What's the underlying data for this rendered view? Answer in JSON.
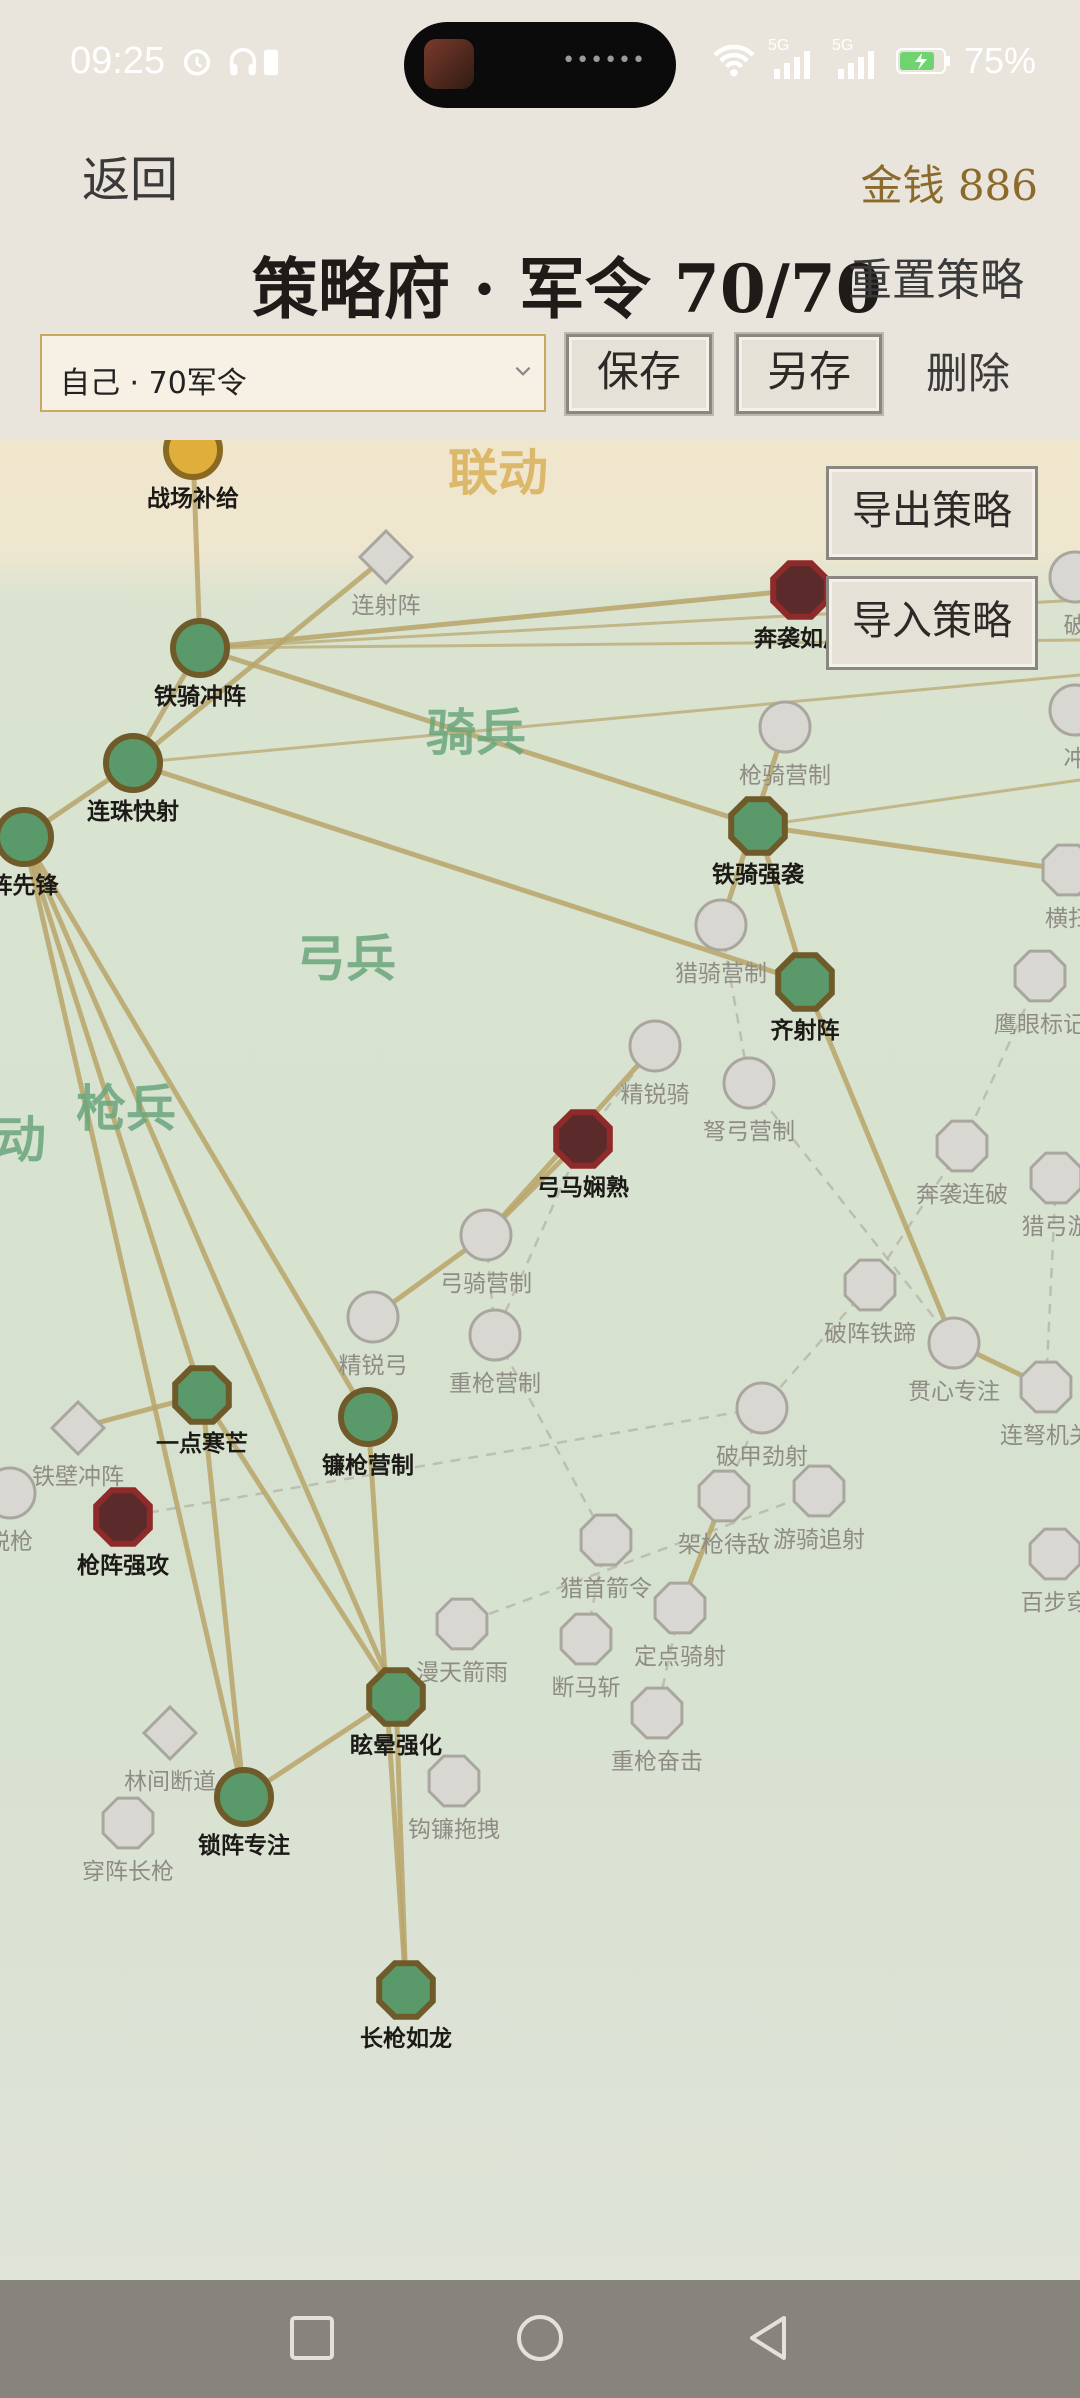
{
  "status_bar": {
    "time": "09:25",
    "network_1": "5G",
    "network_2": "5G",
    "battery": "75%"
  },
  "header": {
    "back_label": "返回",
    "money": "金钱 886",
    "title": "策略府 · 军令 70/70",
    "reset_label": "重置策略"
  },
  "toolbar": {
    "loadout_value": "自己 · 70军令",
    "save_label": "保存",
    "save_as_label": "另存",
    "delete_label": "删除"
  },
  "map": {
    "export_label": "导出策略",
    "import_label": "导入策略",
    "regions": [
      {
        "label": "联动",
        "color": "#d9b15a"
      },
      {
        "label": "骑兵",
        "color": "#6aa67c"
      },
      {
        "label": "弓兵",
        "color": "#6aa67c"
      },
      {
        "label": "枪兵",
        "color": "#6aa67c"
      },
      {
        "label": "动",
        "color": "#6aa67c"
      }
    ],
    "nodes": [
      {
        "label": "战场补给",
        "state": "gold",
        "shape": "circle"
      },
      {
        "label": "连射阵",
        "state": "locked",
        "shape": "diamond"
      },
      {
        "label": "铁骑冲阵",
        "state": "active",
        "shape": "circle"
      },
      {
        "label": "奔袭如风",
        "state": "enemy",
        "shape": "octagon"
      },
      {
        "label": "连珠快射",
        "state": "active",
        "shape": "circle"
      },
      {
        "label": "枪骑营制",
        "state": "locked",
        "shape": "circle"
      },
      {
        "label": "阵先锋",
        "state": "active",
        "shape": "circle"
      },
      {
        "label": "铁骑强袭",
        "state": "active",
        "shape": "octagon"
      },
      {
        "label": "横扫",
        "state": "locked",
        "shape": "octagon"
      },
      {
        "label": "猎骑营制",
        "state": "locked",
        "shape": "circle"
      },
      {
        "label": "齐射阵",
        "state": "active",
        "shape": "octagon"
      },
      {
        "label": "鹰眼标记",
        "state": "locked",
        "shape": "octagon"
      },
      {
        "label": "精锐骑",
        "state": "locked",
        "shape": "circle"
      },
      {
        "label": "弩弓营制",
        "state": "locked",
        "shape": "circle"
      },
      {
        "label": "弓马娴熟",
        "state": "enemy",
        "shape": "octagon"
      },
      {
        "label": "奔袭连破",
        "state": "locked",
        "shape": "octagon"
      },
      {
        "label": "猎弓游",
        "state": "locked",
        "shape": "octagon"
      },
      {
        "label": "弓骑营制",
        "state": "locked",
        "shape": "circle"
      },
      {
        "label": "破阵铁蹄",
        "state": "locked",
        "shape": "octagon"
      },
      {
        "label": "精锐弓",
        "state": "locked",
        "shape": "circle"
      },
      {
        "label": "重枪营制",
        "state": "locked",
        "shape": "circle"
      },
      {
        "label": "贯心专注",
        "state": "locked",
        "shape": "circle"
      },
      {
        "label": "一点寒芒",
        "state": "active",
        "shape": "octagon"
      },
      {
        "label": "镰枪营制",
        "state": "active",
        "shape": "circle"
      },
      {
        "label": "破甲劲射",
        "state": "locked",
        "shape": "circle"
      },
      {
        "label": "连弩机关",
        "state": "locked",
        "shape": "octagon"
      },
      {
        "label": "铁壁冲阵",
        "state": "locked",
        "shape": "diamond"
      },
      {
        "label": "锐枪",
        "state": "locked",
        "shape": "circle"
      },
      {
        "label": "枪阵强攻",
        "state": "enemy",
        "shape": "octagon"
      },
      {
        "label": "架枪待敌",
        "state": "locked",
        "shape": "octagon"
      },
      {
        "label": "游骑追射",
        "state": "locked",
        "shape": "octagon"
      },
      {
        "label": "猎首箭令",
        "state": "locked",
        "shape": "octagon"
      },
      {
        "label": "百步穿",
        "state": "locked",
        "shape": "octagon"
      },
      {
        "label": "漫天箭雨",
        "state": "locked",
        "shape": "octagon"
      },
      {
        "label": "定点骑射",
        "state": "locked",
        "shape": "octagon"
      },
      {
        "label": "断马斩",
        "state": "locked",
        "shape": "octagon"
      },
      {
        "label": "眩晕强化",
        "state": "active",
        "shape": "octagon"
      },
      {
        "label": "重枪奋击",
        "state": "locked",
        "shape": "octagon"
      },
      {
        "label": "林间断道",
        "state": "locked",
        "shape": "diamond"
      },
      {
        "label": "锁阵专注",
        "state": "active",
        "shape": "circle"
      },
      {
        "label": "钩镰拖拽",
        "state": "locked",
        "shape": "octagon"
      },
      {
        "label": "穿阵长枪",
        "state": "locked",
        "shape": "octagon"
      },
      {
        "label": "长枪如龙",
        "state": "active",
        "shape": "octagon"
      },
      {
        "label": "破",
        "state": "locked",
        "shape": "circle"
      },
      {
        "label": "冲",
        "state": "locked",
        "shape": "circle"
      }
    ]
  },
  "colors": {
    "active": "#5a9a6a",
    "active_ring": "#6f5a2a",
    "locked": "#d9d7d2",
    "locked_ring": "#a9a6a0",
    "enemy": "#5b2a2a",
    "enemy_ring": "#8e2a2a",
    "gold": "#e0ae3a",
    "path": "#b9a56a"
  },
  "nav": {
    "recent": "square-icon",
    "home": "circle-icon",
    "back": "triangle-back-icon"
  }
}
